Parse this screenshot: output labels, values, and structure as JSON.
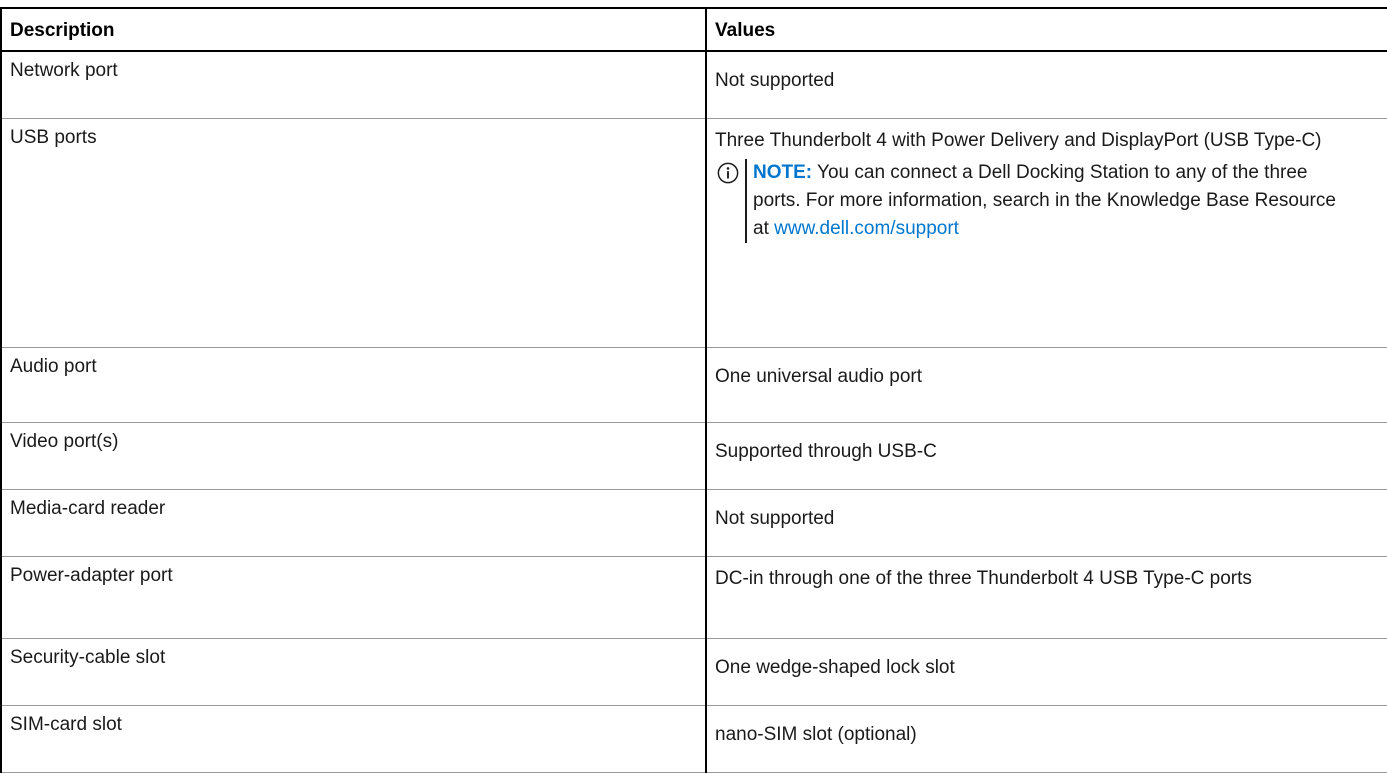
{
  "table": {
    "headers": {
      "description": "Description",
      "values": "Values"
    },
    "rows": [
      {
        "description": "Network port",
        "value": "Not supported"
      },
      {
        "description": "USB ports",
        "value": "Three Thunderbolt 4 with Power Delivery and DisplayPort (USB Type-C)",
        "note": {
          "icon": "info-icon",
          "label": "NOTE:",
          "text": "You can connect a Dell Docking Station to any of the three ports. For more information, search in the Knowledge Base Resource at",
          "link": "www.dell.com/support"
        }
      },
      {
        "description": "Audio port",
        "value": "One universal audio port"
      },
      {
        "description": "Video port(s)",
        "value": "Supported through USB-C"
      },
      {
        "description": "Media-card reader",
        "value": "Not supported"
      },
      {
        "description": "Power-adapter port",
        "value": "DC-in through one of the three Thunderbolt 4 USB Type-C ports"
      },
      {
        "description": "Security-cable slot",
        "value": "One wedge-shaped lock slot"
      },
      {
        "description": "SIM-card slot",
        "value": "nano-SIM slot (optional)"
      }
    ]
  },
  "colors": {
    "link": "#0076ce",
    "text": "#1a1a1a",
    "row_divider": "#9a9a9a"
  }
}
